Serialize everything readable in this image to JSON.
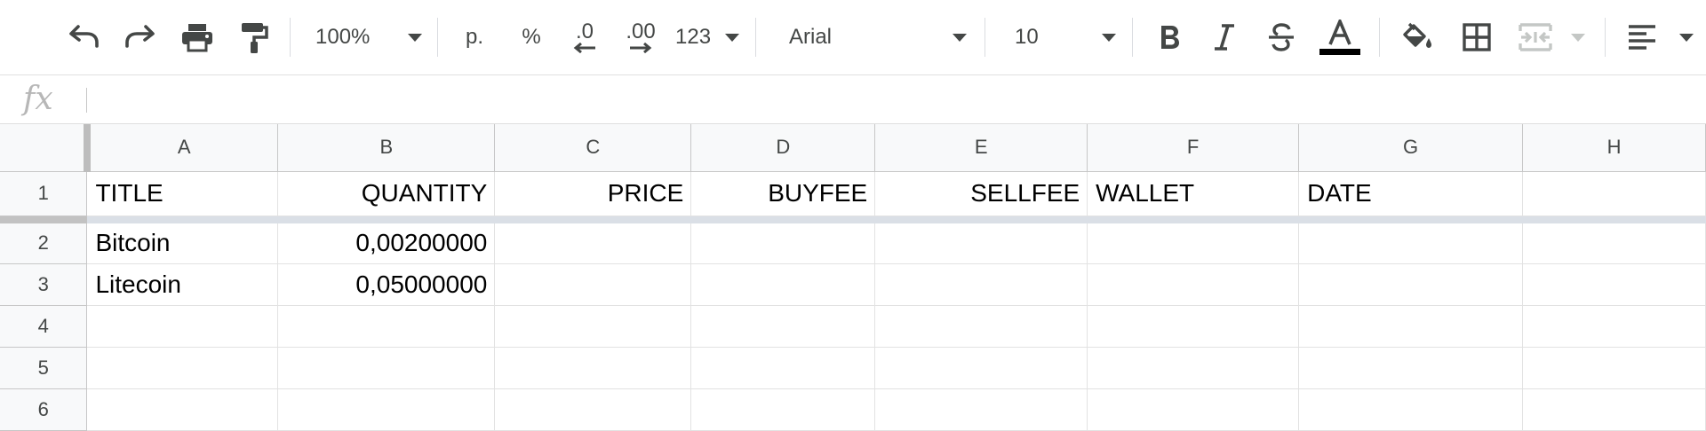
{
  "toolbar": {
    "zoom": "100%",
    "currency_label": "p.",
    "percent_label": "%",
    "decrease_decimals_label": ".0",
    "increase_decimals_label": ".00",
    "more_formats_label": "123",
    "font_family": "Arial",
    "font_size": "10",
    "icons": [
      "undo-icon",
      "redo-icon",
      "print-icon",
      "paint-format-icon",
      "bold-icon",
      "italic-icon",
      "strikethrough-icon",
      "text-color-icon",
      "fill-color-icon",
      "borders-icon",
      "merge-cells-icon",
      "align-left-icon"
    ],
    "text_color": "#000000"
  },
  "formula_bar": {
    "fx_label": "fx",
    "value": ""
  },
  "sheet": {
    "columns": [
      "A",
      "B",
      "C",
      "D",
      "E",
      "F",
      "G",
      "H"
    ],
    "rows": [
      {
        "num": "1",
        "cells": [
          "TITLE",
          "QUANTITY",
          "PRICE",
          "BUYFEE",
          "SELLFEE",
          "WALLET",
          "DATE",
          ""
        ]
      },
      {
        "num": "2",
        "cells": [
          "Bitcoin",
          "0,00200000",
          "",
          "",
          "",
          "",
          "",
          ""
        ]
      },
      {
        "num": "3",
        "cells": [
          "Litecoin",
          "0,05000000",
          "",
          "",
          "",
          "",
          "",
          ""
        ]
      },
      {
        "num": "4",
        "cells": [
          "",
          "",
          "",
          "",
          "",
          "",
          "",
          ""
        ]
      },
      {
        "num": "5",
        "cells": [
          "",
          "",
          "",
          "",
          "",
          "",
          "",
          ""
        ]
      },
      {
        "num": "6",
        "cells": [
          "",
          "",
          "",
          "",
          "",
          "",
          "",
          ""
        ]
      }
    ]
  }
}
